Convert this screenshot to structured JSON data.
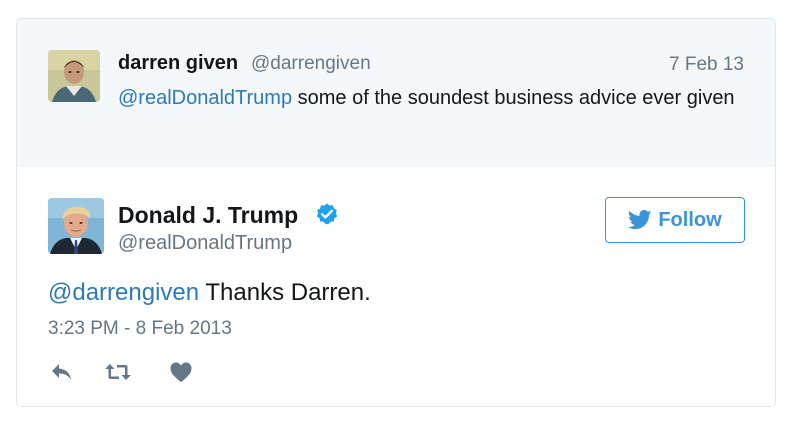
{
  "parent_tweet": {
    "name": "darren given",
    "handle": "@darrengiven",
    "date": "7 Feb 13",
    "mention": "@realDonaldTrump",
    "text": " some of the soundest business advice ever given"
  },
  "tweet": {
    "name": "Donald J. Trump",
    "handle": "@realDonaldTrump",
    "mention": "@darrengiven",
    "text": " Thanks Darren.",
    "timestamp": "3:23 PM - 8 Feb 2013"
  },
  "follow_button": {
    "label": "Follow"
  },
  "icons": {
    "verified": "verified-badge-icon",
    "follow": "twitter-bird-icon",
    "reply": "reply-icon",
    "retweet": "retweet-icon",
    "like": "heart-icon"
  },
  "colors": {
    "link": "#2b7bb9",
    "accent": "#3b94d9",
    "muted": "#657786",
    "icon": "#657786",
    "parent_bg": "#f5f8fa",
    "border": "#e1e8ed"
  }
}
